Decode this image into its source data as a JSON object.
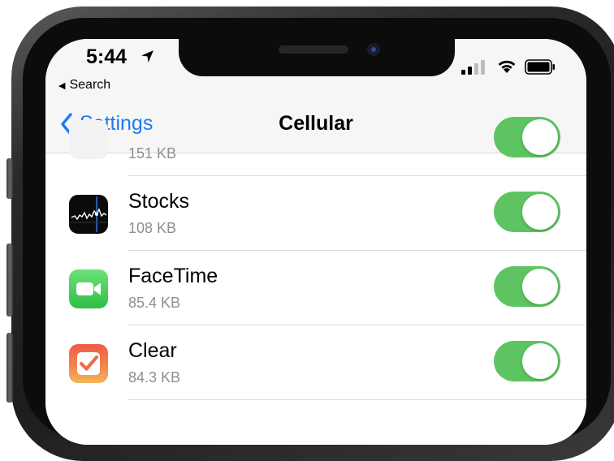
{
  "status_bar": {
    "time": "5:44",
    "back_app": "Search"
  },
  "nav": {
    "back_label": "Settings",
    "title": "Cellular"
  },
  "apps": [
    {
      "name": "",
      "size": "151 KB",
      "enabled": true,
      "icon": "partial-app-icon"
    },
    {
      "name": "Stocks",
      "size": "108 KB",
      "enabled": true,
      "icon": "stocks-icon"
    },
    {
      "name": "FaceTime",
      "size": "85.4 KB",
      "enabled": true,
      "icon": "facetime-icon"
    },
    {
      "name": "Clear",
      "size": "84.3 KB",
      "enabled": true,
      "icon": "clear-icon"
    }
  ],
  "colors": {
    "accent": "#1a7cf5",
    "toggle_on": "#5ec462",
    "secondary_text": "#8e8e93"
  }
}
